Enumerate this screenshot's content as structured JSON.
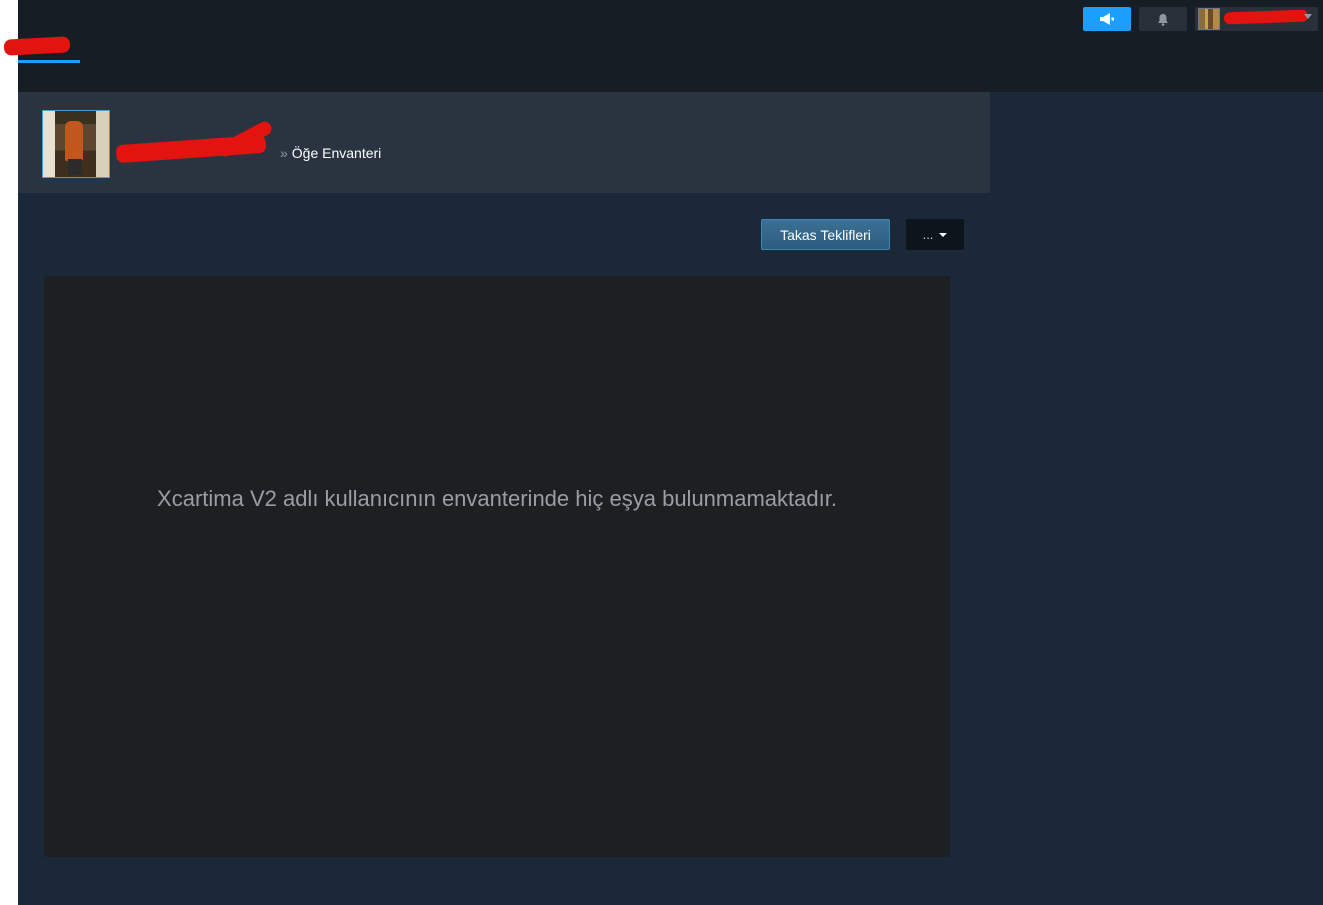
{
  "topbar": {
    "announcement_icon": "megaphone-icon",
    "notification_icon": "bell-icon",
    "account_chevron_icon": "chevron-down-icon"
  },
  "profile": {
    "breadcrumb_separator": "»",
    "breadcrumb_current": "Öğe Envanteri"
  },
  "actions": {
    "trade_offers_label": "Takas Teklifleri",
    "more_label": "..."
  },
  "inventory": {
    "empty_message": "Xcartima V2 adlı kullanıcının envanterinde hiç eşya bulunmamaktadır."
  },
  "colors": {
    "page_bg": "#1b2838",
    "topbar_bg": "#171d25",
    "header_bg": "#2a3441",
    "accent": "#1a9fff",
    "panel_bg": "#1e1f22"
  }
}
